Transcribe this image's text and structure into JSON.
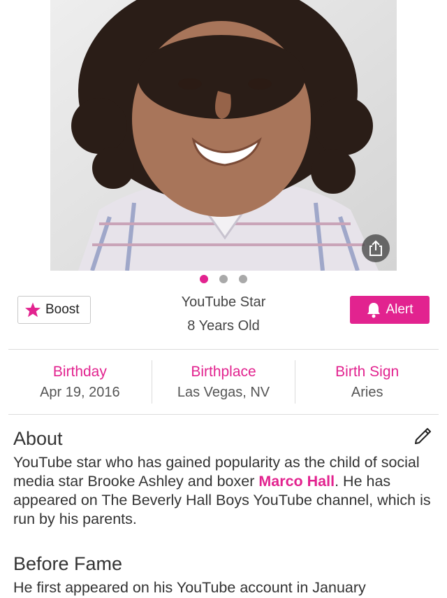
{
  "profile": {
    "profession": "YouTube Star",
    "age": "8 Years Old"
  },
  "actions": {
    "boost_label": "Boost",
    "alert_label": "Alert"
  },
  "carousel": {
    "total": 3,
    "active": 1
  },
  "facts": [
    {
      "label": "Birthday",
      "value": "Apr 19, 2016"
    },
    {
      "label": "Birthplace",
      "value": "Las Vegas, NV"
    },
    {
      "label": "Birth Sign",
      "value": "Aries"
    }
  ],
  "about": {
    "title": "About",
    "text_before": "YouTube star who has gained popularity as the child of social media star Brooke Ashley and boxer ",
    "link": "Marco Hall",
    "text_after": ". He has appeared on The Beverly Hall Boys YouTube channel, which is run by his parents."
  },
  "before_fame": {
    "title": "Before Fame",
    "text": "He first appeared on his YouTube account in January"
  },
  "colors": {
    "accent": "#e2238f",
    "divider": "#dcdcdc"
  },
  "icons": {
    "boost": "star-icon",
    "alert": "bell-icon",
    "share": "share-icon",
    "edit": "pencil-icon"
  }
}
